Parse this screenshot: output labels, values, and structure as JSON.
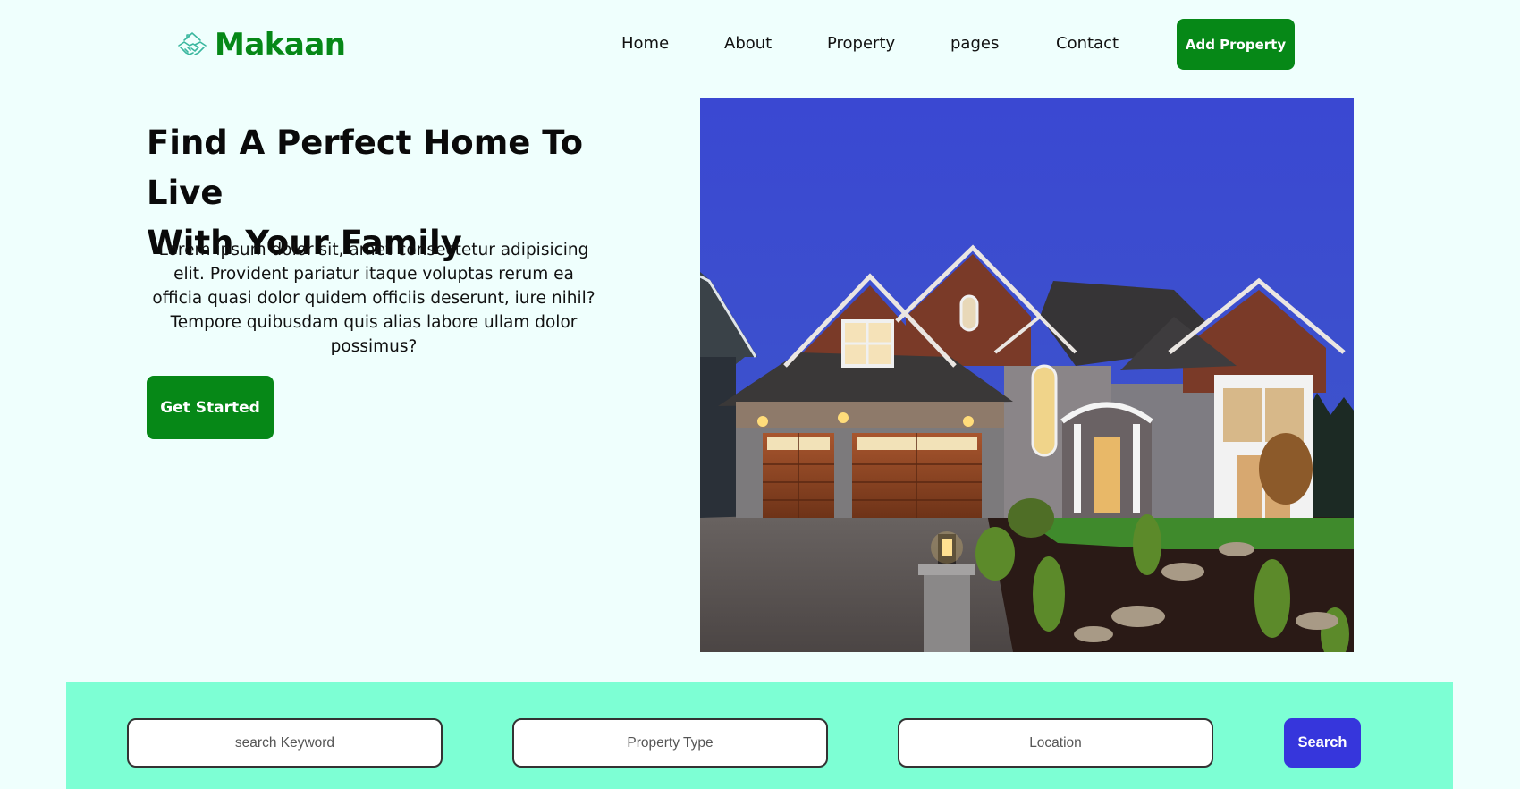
{
  "brand": {
    "name": "Makaan",
    "icon": "handshake-house-icon",
    "color": "#068817"
  },
  "nav": {
    "items": [
      {
        "label": "Home"
      },
      {
        "label": "About"
      },
      {
        "label": "Property"
      },
      {
        "label": "pages"
      },
      {
        "label": "Contact"
      }
    ],
    "cta_label": "Add Property"
  },
  "hero": {
    "title_line1": "Find A Perfect Home To Live",
    "title_line2": "With Your Family",
    "description": "Lorem ipsum dolor sit, amet consectetur adipisicing elit. Provident pariatur itaque voluptas rerum ea officia quasi dolor quidem officiis deserunt, iure nihil? Tempore quibusdam quis alias labore ullam dolor possimus?",
    "cta_label": "Get Started",
    "image": "house-at-dusk-photo"
  },
  "search": {
    "keyword_placeholder": "search Keyword",
    "type_placeholder": "Property Type",
    "location_placeholder": "Location",
    "button_label": "Search"
  },
  "colors": {
    "page_bg": "#effffd",
    "primary_green": "#068817",
    "search_strip": "#7dffd4",
    "search_button": "#3636dc"
  }
}
